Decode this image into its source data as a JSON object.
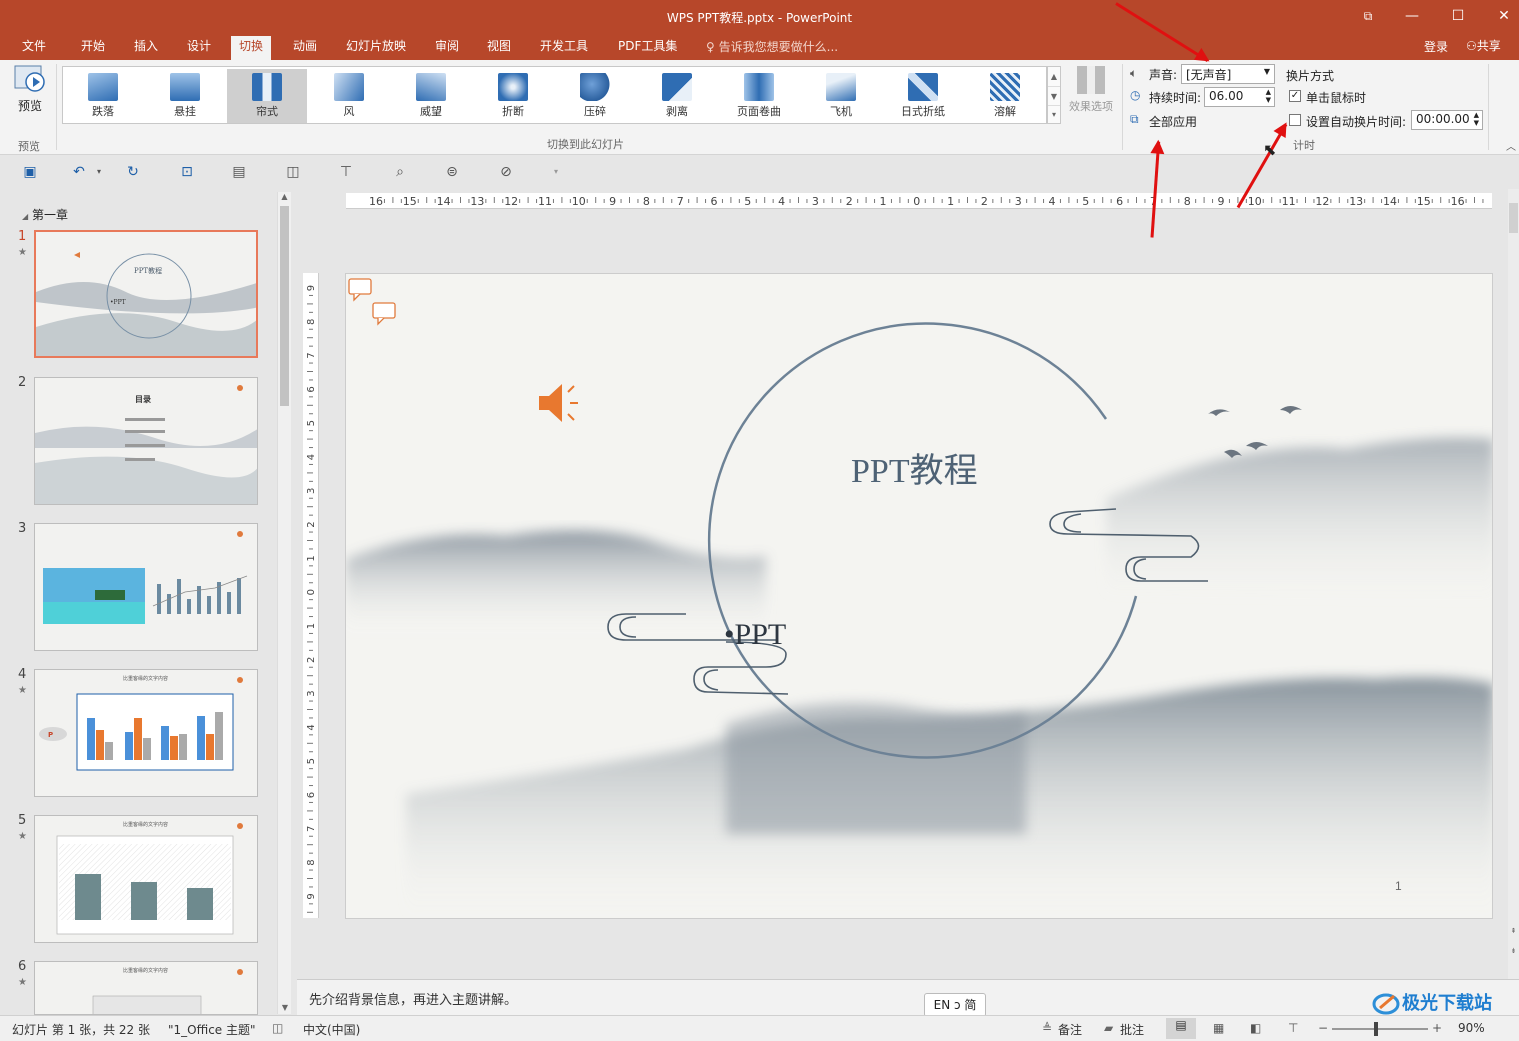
{
  "window": {
    "title": "WPS PPT教程.pptx - PowerPoint"
  },
  "menu": {
    "tabs": [
      "文件",
      "开始",
      "插入",
      "设计",
      "切换",
      "动画",
      "幻灯片放映",
      "审阅",
      "视图",
      "开发工具",
      "PDF工具集"
    ],
    "active_tab": "切换",
    "tell_me": "告诉我您想要做什么...",
    "login": "登录",
    "share": "共享"
  },
  "ribbon": {
    "preview_button": "预览",
    "preview_group": "预览",
    "transitions": [
      "跌落",
      "悬挂",
      "帘式",
      "风",
      "威望",
      "折断",
      "压碎",
      "剥离",
      "页面卷曲",
      "飞机",
      "日式折纸",
      "溶解"
    ],
    "selected_transition": "帘式",
    "effect_options": "效果选项",
    "transition_group": "切换到此幻灯片",
    "sound_label": "声音:",
    "sound_value": "[无声音]",
    "duration_label": "持续时间:",
    "duration_value": "06.00",
    "apply_all": "全部应用",
    "advance_title": "换片方式",
    "on_click_label": "单击鼠标时",
    "on_click_checked": true,
    "auto_after_label": "设置自动换片时间:",
    "auto_after_checked": false,
    "auto_after_value": "00:00.00",
    "timing_group": "计时"
  },
  "slides_pane": {
    "section": "第一章",
    "thumbnails": [
      {
        "num": "1",
        "title": "PPT教程",
        "sub": "•PPT",
        "starred": true
      },
      {
        "num": "2",
        "title": "目录",
        "starred": false
      },
      {
        "num": "3",
        "starred": false
      },
      {
        "num": "4",
        "title": "比重客缘的文字内容",
        "starred": true
      },
      {
        "num": "5",
        "title": "比重客缘的文字内容",
        "starred": true
      },
      {
        "num": "6",
        "title": "比重客缘的文字内容",
        "starred": true
      }
    ]
  },
  "ruler": {
    "h_labels": [
      "16",
      "15",
      "14",
      "13",
      "12",
      "11",
      "10",
      "9",
      "8",
      "7",
      "6",
      "5",
      "4",
      "3",
      "2",
      "1",
      "0",
      "1",
      "2",
      "3",
      "4",
      "5",
      "6",
      "7",
      "8",
      "9",
      "10",
      "11",
      "12",
      "13",
      "14",
      "15",
      "16"
    ],
    "v_labels": [
      "9",
      "8",
      "7",
      "6",
      "5",
      "4",
      "3",
      "2",
      "1",
      "0",
      "1",
      "2",
      "3",
      "4",
      "5",
      "6",
      "7",
      "8",
      "9"
    ]
  },
  "slide": {
    "title": "PPT教程",
    "subtitle": "•PPT",
    "page_number": "1"
  },
  "notes": {
    "text": "先介绍背景信息，再进入主题讲解。"
  },
  "ime": {
    "text": "EN ↄ 简"
  },
  "status": {
    "slide_info": "幻灯片 第 1 张，共 22 张",
    "theme": "\"1_Office 主题\"",
    "language": "中文(中国)",
    "notes_btn": "备注",
    "comments_btn": "批注",
    "zoom": "90%"
  },
  "watermark": {
    "text": "极光下载站"
  }
}
